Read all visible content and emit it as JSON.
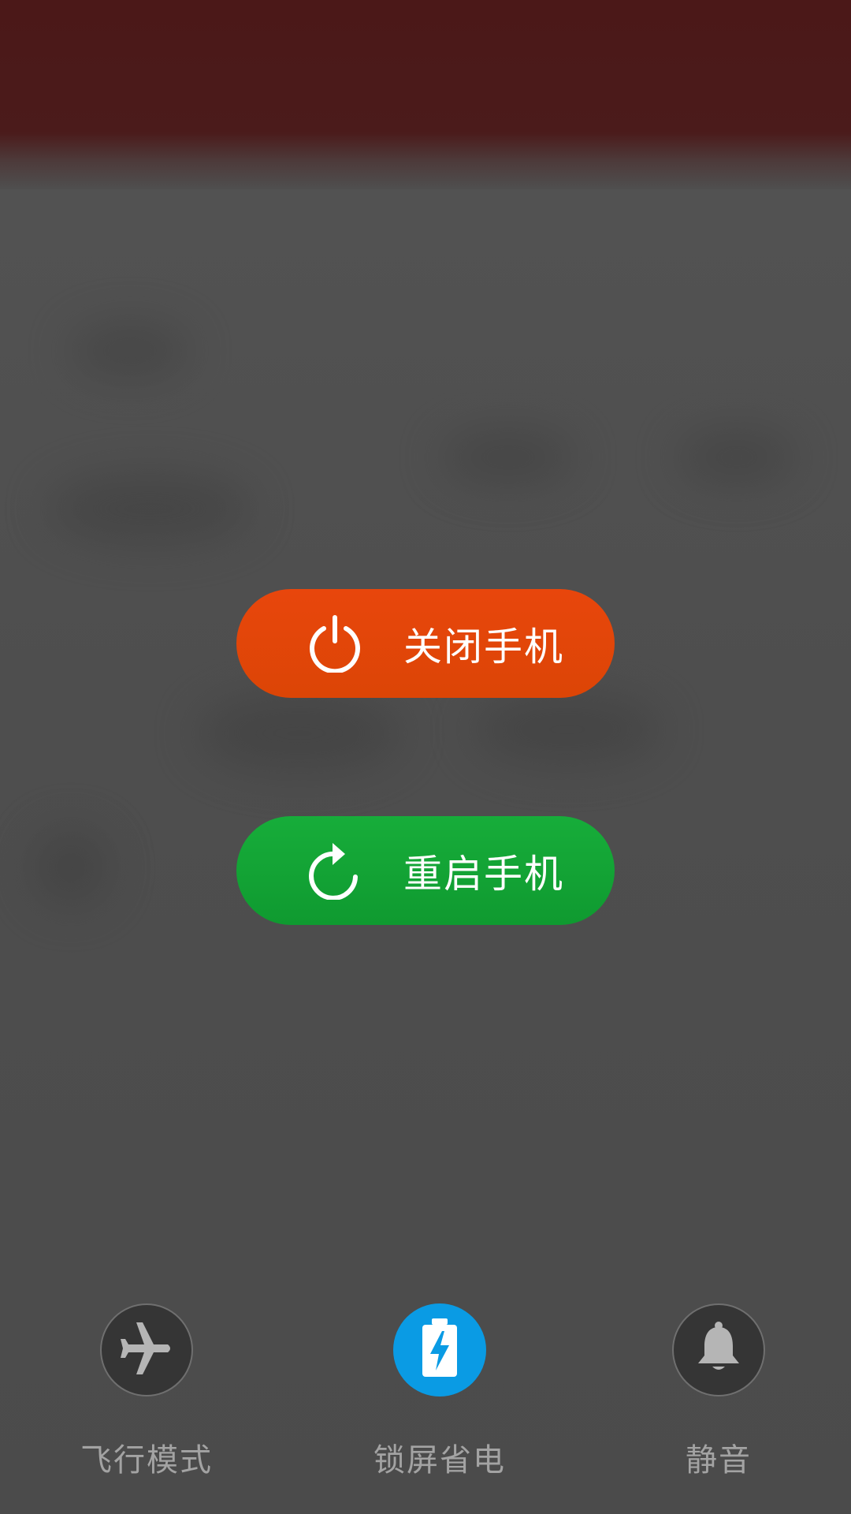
{
  "power_menu": {
    "power_off": {
      "label": "关闭手机",
      "icon": "power-icon",
      "color": "#e4460a"
    },
    "restart": {
      "label": "重启手机",
      "icon": "restart-icon",
      "color": "#13a535"
    }
  },
  "quick_toggles": [
    {
      "label": "飞行模式",
      "icon": "airplane-icon",
      "active": false
    },
    {
      "label": "锁屏省电",
      "icon": "battery-saver-icon",
      "active": true,
      "color": "#0a9be4"
    },
    {
      "label": "静音",
      "icon": "bell-icon",
      "active": false
    }
  ]
}
